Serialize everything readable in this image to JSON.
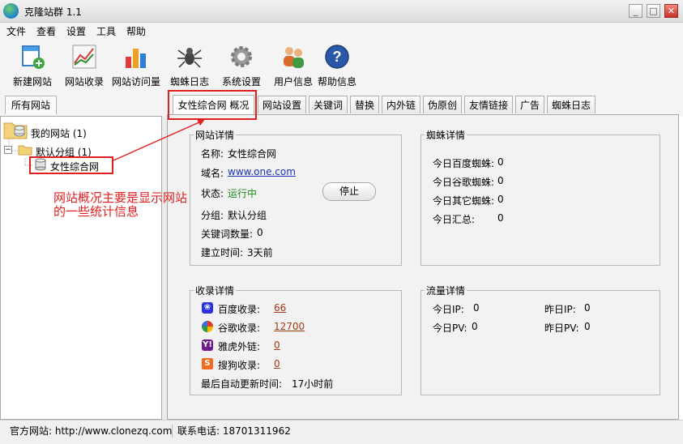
{
  "window": {
    "title": "克隆站群 1.1",
    "minimize": "_",
    "maximize": "□",
    "close": "✕"
  },
  "menu": [
    "文件",
    "查看",
    "设置",
    "工具",
    "帮助"
  ],
  "toolbar": [
    {
      "label": "新建网站",
      "icon": "new-site-icon"
    },
    {
      "label": "网站收录",
      "icon": "chart-icon"
    },
    {
      "label": "网站访问量",
      "icon": "bar-chart-icon"
    },
    {
      "label": "蜘蛛日志",
      "icon": "spider-icon"
    },
    {
      "label": "系统设置",
      "icon": "gear-icon"
    },
    {
      "label": "用户信息",
      "icon": "users-icon"
    },
    {
      "label": "帮助信息",
      "icon": "help-icon"
    }
  ],
  "left_tab": "所有网站",
  "tree": {
    "root": "我的网站 (1)",
    "group": "默认分组 (1)",
    "site": "女性综合网",
    "toggle": "−"
  },
  "tabs": [
    "女性综合网 概况",
    "网站设置",
    "关键词",
    "替换",
    "内外链",
    "伪原创",
    "友情链接",
    "广告",
    "蜘蛛日志"
  ],
  "site_detail": {
    "legend": "网站详情",
    "name_label": "名称:",
    "name_value": "女性综合网",
    "domain_label": "域名:",
    "domain_value": "www.one.com",
    "status_label": "状态:",
    "status_value": "运行中",
    "stop_button": "停止",
    "group_label": "分组:",
    "group_value": "默认分组",
    "keywords_label": "关键词数量:",
    "keywords_value": "0",
    "created_label": "建立时间:",
    "created_value": "3天前"
  },
  "spider_detail": {
    "legend": "蜘蛛详情",
    "rows": [
      {
        "label": "今日百度蜘蛛:",
        "value": "0"
      },
      {
        "label": "今日谷歌蜘蛛:",
        "value": "0"
      },
      {
        "label": "今日其它蜘蛛:",
        "value": "0"
      },
      {
        "label": "今日汇总:",
        "value": "0"
      }
    ]
  },
  "index_detail": {
    "legend": "收录详情",
    "rows": [
      {
        "label": "百度收录:",
        "value": "66",
        "icon": "baidu-icon"
      },
      {
        "label": "谷歌收录:",
        "value": "12700",
        "icon": "google-icon"
      },
      {
        "label": "雅虎外链:",
        "value": "0",
        "icon": "yahoo-icon"
      },
      {
        "label": "搜狗收录:",
        "value": "0",
        "icon": "sogou-icon"
      }
    ],
    "updated_label": "最后自动更新时间:",
    "updated_value": "17小时前"
  },
  "traffic_detail": {
    "legend": "流量详情",
    "today_ip_label": "今日IP:",
    "today_ip_value": "0",
    "yesterday_ip_label": "昨日IP:",
    "yesterday_ip_value": "0",
    "today_pv_label": "今日PV:",
    "today_pv_value": "0",
    "yesterday_pv_label": "昨日PV:",
    "yesterday_pv_value": "0"
  },
  "annotation": {
    "line1": "网站概况主要是显示网站",
    "line2": "的一些统计信息",
    "color": "#e02020"
  },
  "status": {
    "website": "官方网站: http://www.clonezq.com",
    "phone": "联系电话: 18701311962"
  }
}
